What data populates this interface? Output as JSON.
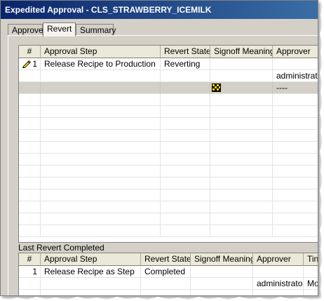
{
  "window": {
    "title": "Expedited Approval - CLS_STRAWBERRY_ICEMILK"
  },
  "tabs": [
    {
      "label": "Approve",
      "active": false
    },
    {
      "label": "Revert",
      "active": true
    },
    {
      "label": "Summary",
      "active": false
    }
  ],
  "top_grid": {
    "headers": {
      "num": "#",
      "step": "Approval Step",
      "state": "Revert State",
      "meaning": "Signoff Meaning",
      "approver": "Approver"
    },
    "rows": [
      {
        "num": "1",
        "step": "Release Recipe to Production",
        "state": "Reverting",
        "meaning": "",
        "approver": "",
        "icon": "pencil-icon"
      },
      {
        "num": "",
        "step": "",
        "state": "",
        "meaning": "",
        "approver": "administrato"
      },
      {
        "num": "",
        "step": "",
        "state": "",
        "meaning": "",
        "approver": "----",
        "icon": "signoff-icon",
        "selected": true
      }
    ]
  },
  "bottom_section": {
    "label": "Last Revert Completed"
  },
  "bottom_grid": {
    "headers": {
      "num": "#",
      "step": "Approval Step",
      "state": "Revert State",
      "meaning": "Signoff Meaning",
      "approver": "Approver",
      "time": "Tin"
    },
    "rows": [
      {
        "num": "1",
        "step": "Release Recipe as Step",
        "state": "Completed",
        "meaning": "",
        "approver": "",
        "time": ""
      },
      {
        "num": "",
        "step": "",
        "state": "",
        "meaning": "",
        "approver": "administrator",
        "time": "Mo"
      }
    ]
  },
  "colors": {
    "titlebar_start": "#0a246a",
    "titlebar_end": "#3a6ea5",
    "dialog_bg": "#d4d0c8",
    "grid_bg": "#ffffff",
    "selected_row": "#d4d0c8",
    "pencil_yellow": "#f5d000"
  }
}
